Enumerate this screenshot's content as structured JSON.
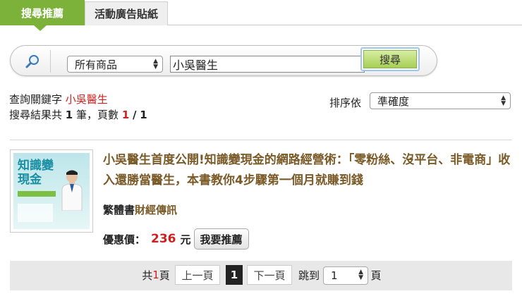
{
  "tabs": {
    "active": "搜尋推薦",
    "inactive": "活動廣告貼紙"
  },
  "search": {
    "category_selected": "所有商品",
    "query_value": "小吳醫生",
    "button_label": "搜尋"
  },
  "query_info": {
    "keyword_label": "查詢關鍵字",
    "keyword_value": "小吳醫生",
    "results_prefix": "搜尋結果共",
    "results_count": "1",
    "results_unit": "筆，頁數",
    "current_page": "1",
    "page_sep": "/",
    "total_pages": "1"
  },
  "sort": {
    "label": "排序依",
    "selected": "準確度"
  },
  "product": {
    "title": "小吳醫生首度公開!知識變現金的網路經營術：「零粉絲、沒平台、非電商」收入還勝當醫生，本書教你4步驟第一個月就賺到錢",
    "format": "繁體書",
    "publisher": "財經傳訊",
    "price_label": "優惠價：",
    "price": "236",
    "price_unit": "元",
    "recommend_label": "我要推薦",
    "cover_text": "知識變現金"
  },
  "pagination": {
    "total_prefix": "共",
    "total_pages": "1",
    "total_suffix": "頁",
    "prev_label": "上一頁",
    "current_page": "1",
    "next_label": "下一頁",
    "jump_label": "跳到",
    "jump_value": "1",
    "jump_suffix": "頁"
  },
  "colors": {
    "accent_green": "#7db23a",
    "highlight_red": "#d0211f",
    "title_brown": "#7a5a27"
  }
}
